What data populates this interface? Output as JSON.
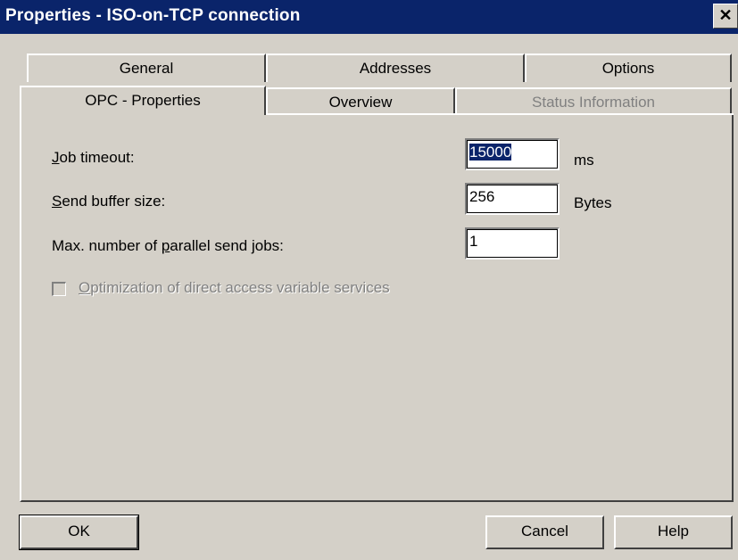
{
  "window": {
    "title": "Properties - ISO-on-TCP connection",
    "close_glyph": "✕"
  },
  "tabs": {
    "back_row": [
      {
        "label": "General",
        "enabled": true
      },
      {
        "label": "Addresses",
        "enabled": true
      },
      {
        "label": "Options",
        "enabled": true
      }
    ],
    "front_row": [
      {
        "label": "OPC - Properties",
        "enabled": true,
        "active": true
      },
      {
        "label": "Overview",
        "enabled": true
      },
      {
        "label": "Status Information",
        "enabled": false
      }
    ]
  },
  "form": {
    "job_timeout": {
      "label_accel": "J",
      "label_rest": "ob timeout:",
      "value": "15000",
      "unit": "ms"
    },
    "send_buffer": {
      "label_accel": "S",
      "label_rest": "end buffer size:",
      "value": "256",
      "unit": "Bytes"
    },
    "parallel_jobs": {
      "label_pre": "Max. number of ",
      "label_accel": "p",
      "label_rest": "arallel send jobs:",
      "value": "1"
    },
    "optimization": {
      "label_accel": "O",
      "label_rest": "ptimization of direct access variable services",
      "checked": false,
      "enabled": false
    }
  },
  "buttons": {
    "ok": "OK",
    "cancel": "Cancel",
    "help": "Help"
  },
  "colors": {
    "titlebar": "#0a246a",
    "face": "#d4d0c8",
    "disabled_text": "#808080"
  }
}
